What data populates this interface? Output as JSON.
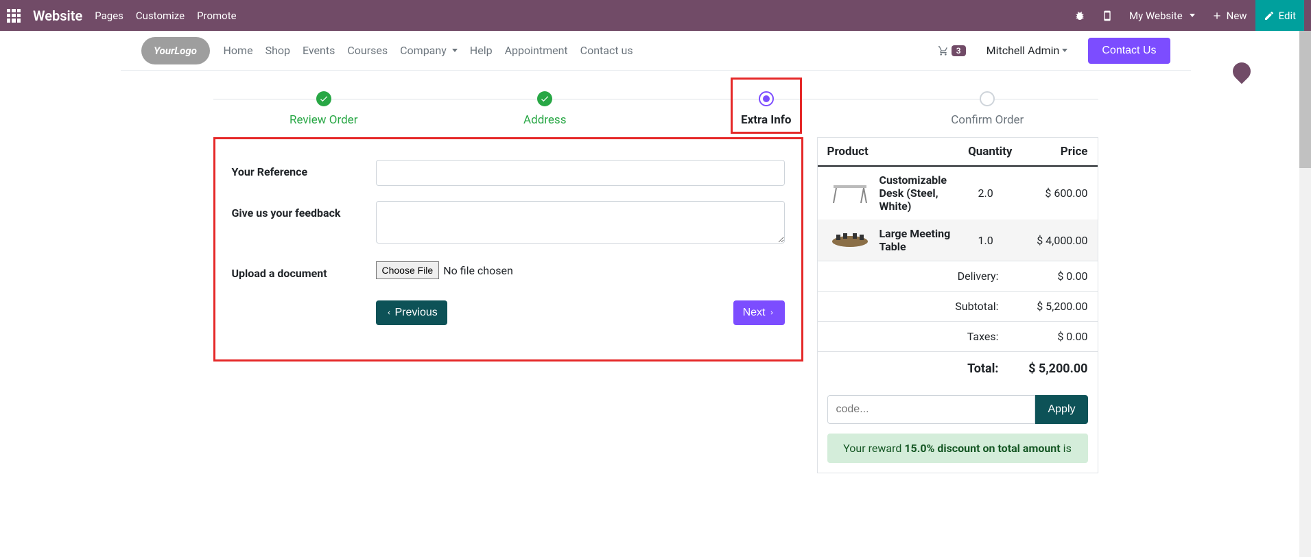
{
  "admin": {
    "brand": "Website",
    "menu": [
      "Pages",
      "Customize",
      "Promote"
    ],
    "my_website": "My Website",
    "new": "New",
    "edit": "Edit"
  },
  "nav": {
    "logo_text": "YourLogo",
    "links": [
      "Home",
      "Shop",
      "Events",
      "Courses",
      "Company",
      "Help",
      "Appointment",
      "Contact us"
    ],
    "cart_count": "3",
    "user": "Mitchell Admin",
    "contact_btn": "Contact Us"
  },
  "wizard": {
    "steps": [
      {
        "label": "Review Order",
        "state": "done"
      },
      {
        "label": "Address",
        "state": "done"
      },
      {
        "label": "Extra Info",
        "state": "current"
      },
      {
        "label": "Confirm Order",
        "state": "pending"
      }
    ]
  },
  "form": {
    "reference_label": "Your Reference",
    "feedback_label": "Give us your feedback",
    "upload_label": "Upload a document",
    "choose_file": "Choose File",
    "no_file": "No file chosen",
    "prev": "Previous",
    "next": "Next"
  },
  "summary": {
    "headers": {
      "product": "Product",
      "qty": "Quantity",
      "price": "Price"
    },
    "items": [
      {
        "name": "Customizable Desk (Steel, White)",
        "qty": "2.0",
        "price": "$ 600.00"
      },
      {
        "name": "Large Meeting Table",
        "qty": "1.0",
        "price": "$ 4,000.00"
      }
    ],
    "delivery_label": "Delivery:",
    "delivery_val": "$ 0.00",
    "subtotal_label": "Subtotal:",
    "subtotal_val": "$ 5,200.00",
    "taxes_label": "Taxes:",
    "taxes_val": "$ 0.00",
    "total_label": "Total:",
    "total_val": "$ 5,200.00",
    "code_placeholder": "code...",
    "apply": "Apply",
    "reward_prefix": "Your reward ",
    "reward_bold": "15.0% discount on total amount",
    "reward_suffix": " is"
  }
}
